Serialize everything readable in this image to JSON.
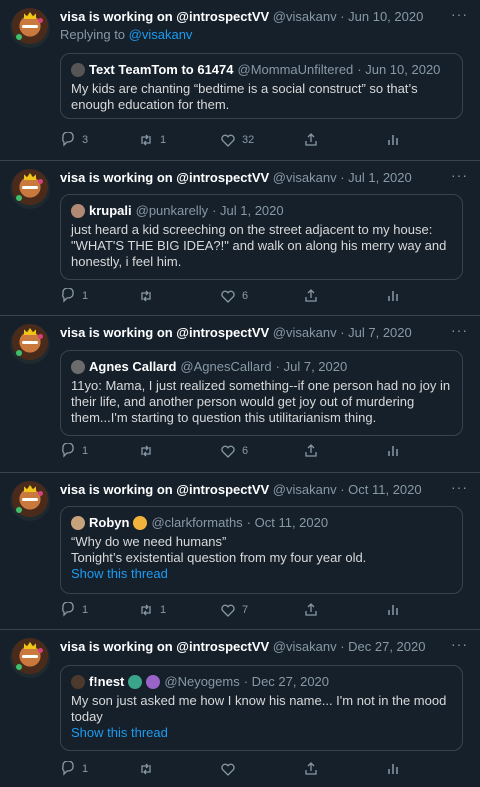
{
  "replying_to": {
    "prefix": "Replying to ",
    "handle": "@visakanv"
  },
  "tweets": [
    {
      "author_name": "visa is working on @introspectVV",
      "handle": "@visakanv",
      "date": "· Jun 10, 2020",
      "quote": {
        "name": "Text TeamTom to 61474",
        "handle": "@MommaUnfiltered",
        "date": "· Jun 10, 2020",
        "text": "My kids are chanting “bedtime is a social construct” so that’s enough education for them.",
        "show_thread": ""
      },
      "replies": "3",
      "retweets": "1",
      "likes": "32"
    },
    {
      "author_name": "visa is working on @introspectVV",
      "handle": "@visakanv",
      "date": "· Jul 1, 2020",
      "quote": {
        "name": "krupali",
        "handle": "@punkarelly",
        "date": "· Jul 1, 2020",
        "text": "just heard a kid screeching on the street adjacent to my house: \"WHAT'S THE BIG IDEA?!\" and walk on along his merry way and honestly, i feel him.",
        "show_thread": ""
      },
      "replies": "1",
      "retweets": "",
      "likes": "6"
    },
    {
      "author_name": "visa is working on @introspectVV",
      "handle": "@visakanv",
      "date": "· Jul 7, 2020",
      "quote": {
        "name": "Agnes Callard",
        "handle": "@AgnesCallard",
        "date": "· Jul 7, 2020",
        "text": "11yo: Mama, I just realized something--if one person had no joy in their life, and another person would get joy out of murdering them...I'm starting to question this utilitarianism thing.",
        "show_thread": ""
      },
      "replies": "1",
      "retweets": "",
      "likes": "6"
    },
    {
      "author_name": "visa is working on @introspectVV",
      "handle": "@visakanv",
      "date": "· Oct 11, 2020",
      "quote": {
        "name": "Robyn",
        "handle": "@clarkformaths",
        "date": "· Oct 11, 2020",
        "text": "“Why do we need humans”\nTonight’s existential question from my four year old.",
        "show_thread": "Show this thread"
      },
      "replies": "1",
      "retweets": "1",
      "likes": "7"
    },
    {
      "author_name": "visa is working on @introspectVV",
      "handle": "@visakanv",
      "date": "· Dec 27, 2020",
      "quote": {
        "name": "f!nest",
        "handle": "@Neyogems",
        "date": "· Dec 27, 2020",
        "text": "My son just asked me how I know his name... I'm not in the mood today",
        "show_thread": "Show this thread"
      },
      "replies": "1",
      "retweets": "",
      "likes": ""
    }
  ],
  "colors": {
    "background": "#15202b",
    "accent": "#1d9bf0",
    "muted": "#8899a6",
    "border": "#38444d"
  },
  "icons": [
    "more-icon",
    "reply-icon",
    "retweet-icon",
    "like-icon",
    "share-icon",
    "analytics-icon"
  ]
}
